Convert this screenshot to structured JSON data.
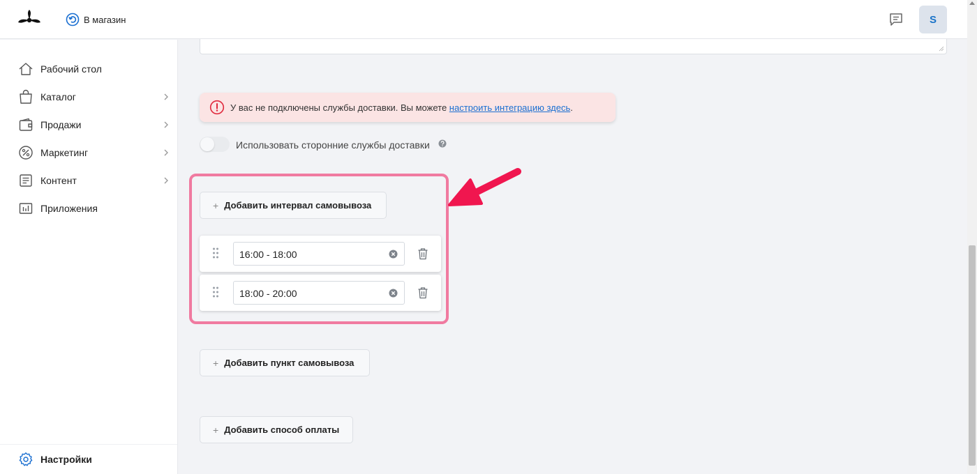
{
  "topbar": {
    "store_link": "В магазин",
    "avatar_initial": "S",
    "logo_icon": "propeller-logo-icon",
    "chat_icon": "chat-icon"
  },
  "sidebar": {
    "items": [
      {
        "label": "Рабочий стол",
        "icon": "home-icon",
        "has_children": false
      },
      {
        "label": "Каталог",
        "icon": "shopping-bag-icon",
        "has_children": true
      },
      {
        "label": "Продажи",
        "icon": "wallet-icon",
        "has_children": true
      },
      {
        "label": "Маркетинг",
        "icon": "percent-icon",
        "has_children": true
      },
      {
        "label": "Контент",
        "icon": "document-icon",
        "has_children": true
      },
      {
        "label": "Приложения",
        "icon": "bar-chart-icon",
        "has_children": false
      }
    ],
    "settings": {
      "label": "Настройки",
      "icon": "gear-icon"
    }
  },
  "main": {
    "alert": {
      "text": "У вас не подключены службы доставки. Вы можете ",
      "link": "настроить интеграцию здесь",
      "suffix": "."
    },
    "toggle": {
      "label": "Использовать сторонние службы доставки",
      "enabled": false
    },
    "add_interval_button": "Добавить интервал самовывоза",
    "intervals": [
      {
        "value": "16:00 - 18:00"
      },
      {
        "value": "18:00 - 20:00"
      }
    ],
    "add_pickup_button": "Добавить пункт самовывоза",
    "add_payment_button": "Добавить способ оплаты",
    "plus_symbol": "+"
  },
  "colors": {
    "accent": "#1a6fd1",
    "highlight": "#f07aa0",
    "arrow": "#f0164f",
    "alert_bg": "#fbe4e4",
    "alert_icon": "#e0283c"
  }
}
